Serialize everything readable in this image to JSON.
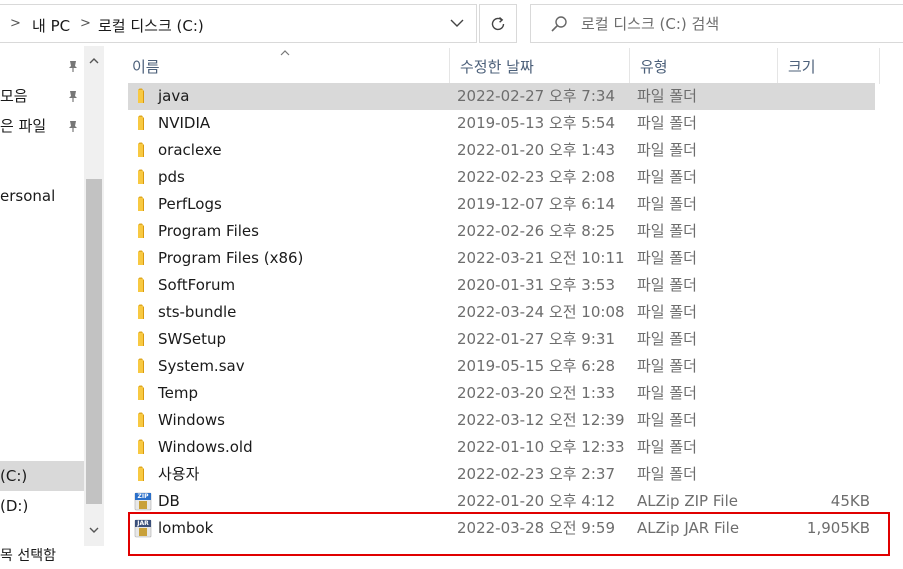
{
  "address": {
    "crumbs": [
      "내 PC",
      "로컬 디스크 (C:)"
    ],
    "separator": ">"
  },
  "search": {
    "placeholder": "로컬 디스크 (C:) 검색"
  },
  "nav": {
    "items": [
      {
        "label": "모음",
        "pinned": true
      },
      {
        "label": "은 파일",
        "pinned": true
      },
      {
        "label": "ersonal",
        "pinned": false
      },
      {
        "label": "(C:)",
        "pinned": false,
        "selected": true
      },
      {
        "label": "(D:)",
        "pinned": false
      }
    ],
    "top_pinned": true
  },
  "status_text": "목 선택함",
  "columns": {
    "name": "이름",
    "date": "수정한 날짜",
    "type": "유형",
    "size": "크기"
  },
  "files": [
    {
      "name": "java",
      "date": "2022-02-27 오후 7:34",
      "type": "파일 폴더",
      "size": "",
      "icon": "folder-icon",
      "selected": true
    },
    {
      "name": "NVIDIA",
      "date": "2019-05-13 오후 5:54",
      "type": "파일 폴더",
      "size": "",
      "icon": "folder-icon"
    },
    {
      "name": "oraclexe",
      "date": "2022-01-20 오후 1:43",
      "type": "파일 폴더",
      "size": "",
      "icon": "folder-icon"
    },
    {
      "name": "pds",
      "date": "2022-02-23 오후 2:08",
      "type": "파일 폴더",
      "size": "",
      "icon": "folder-icon"
    },
    {
      "name": "PerfLogs",
      "date": "2019-12-07 오후 6:14",
      "type": "파일 폴더",
      "size": "",
      "icon": "folder-icon"
    },
    {
      "name": "Program Files",
      "date": "2022-02-26 오후 8:25",
      "type": "파일 폴더",
      "size": "",
      "icon": "folder-icon"
    },
    {
      "name": "Program Files (x86)",
      "date": "2022-03-21 오전 10:11",
      "type": "파일 폴더",
      "size": "",
      "icon": "folder-icon"
    },
    {
      "name": "SoftForum",
      "date": "2020-01-31 오후 3:53",
      "type": "파일 폴더",
      "size": "",
      "icon": "folder-icon"
    },
    {
      "name": "sts-bundle",
      "date": "2022-03-24 오전 10:08",
      "type": "파일 폴더",
      "size": "",
      "icon": "folder-icon"
    },
    {
      "name": "SWSetup",
      "date": "2022-01-27 오후 9:31",
      "type": "파일 폴더",
      "size": "",
      "icon": "folder-icon"
    },
    {
      "name": "System.sav",
      "date": "2019-05-15 오후 6:28",
      "type": "파일 폴더",
      "size": "",
      "icon": "folder-icon"
    },
    {
      "name": "Temp",
      "date": "2022-03-20 오전 1:33",
      "type": "파일 폴더",
      "size": "",
      "icon": "folder-icon"
    },
    {
      "name": "Windows",
      "date": "2022-03-12 오전 12:39",
      "type": "파일 폴더",
      "size": "",
      "icon": "folder-icon"
    },
    {
      "name": "Windows.old",
      "date": "2022-01-10 오후 12:33",
      "type": "파일 폴더",
      "size": "",
      "icon": "folder-icon"
    },
    {
      "name": "사용자",
      "date": "2022-02-23 오후 2:37",
      "type": "파일 폴더",
      "size": "",
      "icon": "folder-icon"
    },
    {
      "name": "DB",
      "date": "2022-01-20 오후 4:12",
      "type": "ALZip ZIP File",
      "size": "45KB",
      "icon": "zip-file-icon",
      "badge": "ZIP"
    },
    {
      "name": "lombok",
      "date": "2022-03-28 오전 9:59",
      "type": "ALZip JAR File",
      "size": "1,905KB",
      "icon": "jar-file-icon",
      "badge": "JAR",
      "highlighted": true
    }
  ],
  "colors": {
    "selected_row": "#d9d9d9",
    "highlight_border": "#e00000",
    "folder": "#f8c942",
    "header_text": "#4c607a"
  }
}
